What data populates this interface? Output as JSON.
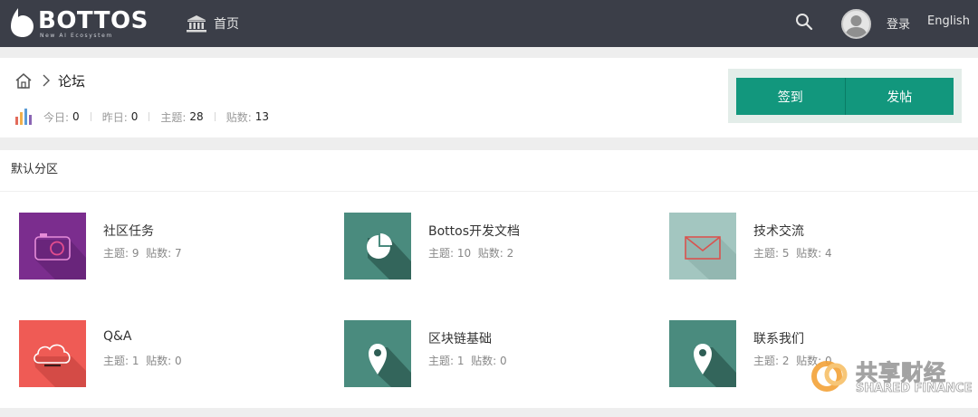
{
  "brand": {
    "name": "BOTTOS",
    "tagline": "New AI Ecosystem"
  },
  "nav": {
    "home_label": "首页",
    "login_label": "登录",
    "lang_label": "English"
  },
  "breadcrumb": {
    "current": "论坛"
  },
  "stats": [
    {
      "label": "今日:",
      "value": "0"
    },
    {
      "label": "昨日:",
      "value": "0"
    },
    {
      "label": "主题:",
      "value": "28"
    },
    {
      "label": "贴数:",
      "value": "13"
    }
  ],
  "actions": {
    "checkin": "签到",
    "post": "发帖"
  },
  "section": {
    "title": "默认分区",
    "forums": [
      {
        "name": "社区任务",
        "topics_label": "主题:",
        "topics": "9",
        "posts_label": "贴数:",
        "posts": "7",
        "icon": "camera-icon",
        "color": "#7b2d8e"
      },
      {
        "name": "Bottos开发文档",
        "topics_label": "主题:",
        "topics": "10",
        "posts_label": "贴数:",
        "posts": "2",
        "icon": "pie-chart-icon",
        "color": "#4a8b7e"
      },
      {
        "name": "技术交流",
        "topics_label": "主题:",
        "topics": "5",
        "posts_label": "贴数:",
        "posts": "4",
        "icon": "envelope-icon",
        "color": "#a3c6c0"
      },
      {
        "name": "Q&A",
        "topics_label": "主题:",
        "topics": "1",
        "posts_label": "贴数:",
        "posts": "0",
        "icon": "cloud-icon",
        "color": "#ef5b55"
      },
      {
        "name": "区块链基础",
        "topics_label": "主题:",
        "topics": "1",
        "posts_label": "贴数:",
        "posts": "0",
        "icon": "map-pin-icon",
        "color": "#4a8b7e"
      },
      {
        "name": "联系我们",
        "topics_label": "主题:",
        "topics": "2",
        "posts_label": "贴数:",
        "posts": "0",
        "icon": "map-pin-icon",
        "color": "#4a8b7e"
      }
    ]
  },
  "watermark": {
    "cn": "共享财经",
    "en": "SHARED FINANCE"
  }
}
